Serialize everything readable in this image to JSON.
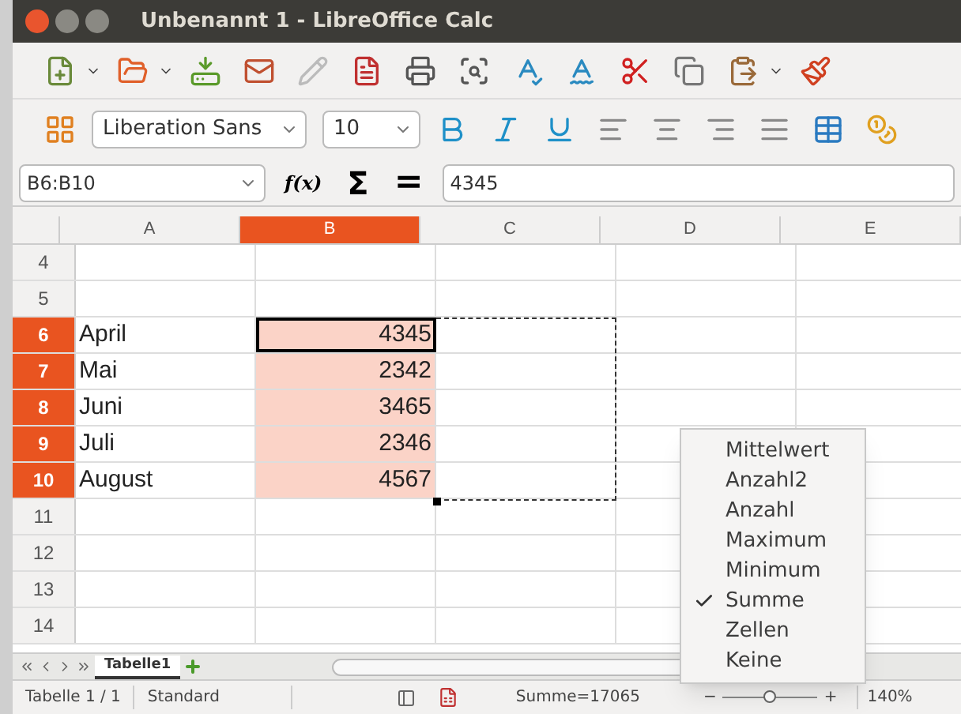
{
  "window": {
    "title": "Unbenannt 1 - LibreOffice Calc"
  },
  "formatting": {
    "font_name": "Liberation Sans",
    "font_size": "10"
  },
  "formula_bar": {
    "name_box": "B6:B10",
    "function_wizard": "f(x)",
    "sum": "Σ",
    "equals": "=",
    "formula": "4345"
  },
  "columns": [
    {
      "label": "A",
      "selected": false
    },
    {
      "label": "B",
      "selected": true
    },
    {
      "label": "C",
      "selected": false
    },
    {
      "label": "D",
      "selected": false
    },
    {
      "label": "E",
      "selected": false
    }
  ],
  "rows": [
    {
      "label": "4",
      "selected": false,
      "active": false,
      "cells": [
        "",
        ""
      ]
    },
    {
      "label": "5",
      "selected": false,
      "active": false,
      "cells": [
        "",
        ""
      ]
    },
    {
      "label": "6",
      "selected": true,
      "active": true,
      "cells": [
        "April",
        "4345"
      ]
    },
    {
      "label": "7",
      "selected": true,
      "active": false,
      "cells": [
        "Mai",
        "2342"
      ]
    },
    {
      "label": "8",
      "selected": true,
      "active": false,
      "cells": [
        "Juni",
        "3465"
      ]
    },
    {
      "label": "9",
      "selected": true,
      "active": false,
      "cells": [
        "Juli",
        "2346"
      ]
    },
    {
      "label": "10",
      "selected": true,
      "active": false,
      "cells": [
        "August",
        "4567"
      ]
    },
    {
      "label": "11",
      "selected": false,
      "active": false,
      "cells": [
        "",
        ""
      ]
    },
    {
      "label": "12",
      "selected": false,
      "active": false,
      "cells": [
        "",
        ""
      ]
    },
    {
      "label": "13",
      "selected": false,
      "active": false,
      "cells": [
        "",
        ""
      ]
    },
    {
      "label": "14",
      "selected": false,
      "active": false,
      "cells": [
        "",
        ""
      ]
    }
  ],
  "sheet_tabs": [
    {
      "label": "Tabelle1",
      "selected": true
    }
  ],
  "status_bar": {
    "sheet": "Tabelle 1 / 1",
    "page_style": "Standard",
    "selection_sum": "Summe=17065",
    "zoom_minus": "−",
    "zoom_plus": "+",
    "zoom_slider": {
      "level": 0.5
    },
    "zoom": "140%"
  },
  "context_menu": [
    {
      "label": "Mittelwert",
      "checked": false
    },
    {
      "label": "Anzahl2",
      "checked": false
    },
    {
      "label": "Anzahl",
      "checked": false
    },
    {
      "label": "Maximum",
      "checked": false
    },
    {
      "label": "Minimum",
      "checked": false
    },
    {
      "label": "Summe",
      "checked": true
    },
    {
      "label": "Zellen",
      "checked": false
    },
    {
      "label": "Keine",
      "checked": false
    }
  ]
}
